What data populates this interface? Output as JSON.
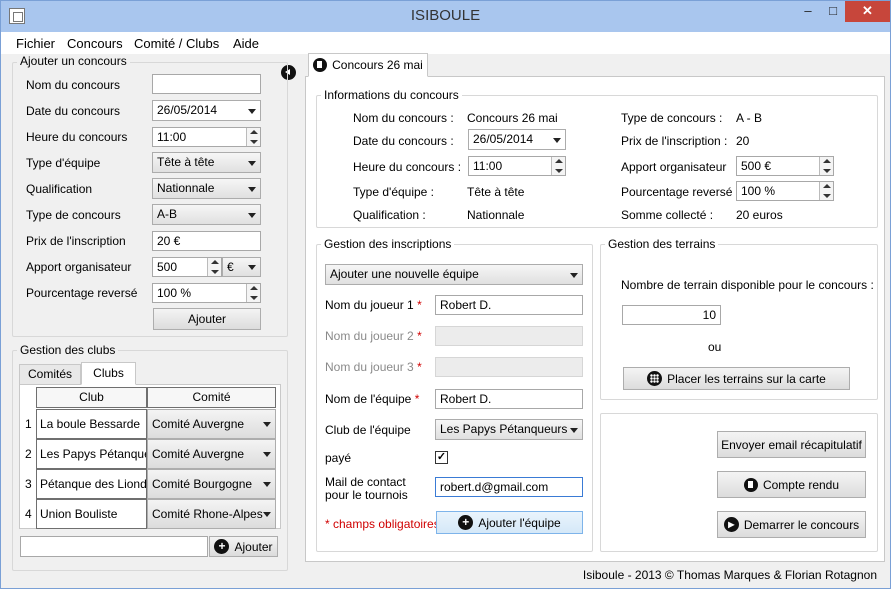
{
  "window": {
    "title": "ISIBOULE"
  },
  "menu": [
    "Fichier",
    "Concours",
    "Comité / Clubs",
    "Aide"
  ],
  "left": {
    "add_group_title": "Ajouter un concours",
    "fields": {
      "nom_label": "Nom du concours",
      "nom_value": "",
      "date_label": "Date du concours",
      "date_value": "26/05/2014",
      "heure_label": "Heure du concours",
      "heure_value": "11:00",
      "type_equipe_label": "Type d'équipe",
      "type_equipe_value": "Tête à tête",
      "qualification_label": "Qualification",
      "qualification_value": "Nationnale",
      "type_concours_label": "Type de concours",
      "type_concours_value": "A-B",
      "prix_label": "Prix de l'inscription",
      "prix_value": "20 €",
      "apport_label": "Apport organisateur",
      "apport_value": "500",
      "apport_currency": "€",
      "pourcentage_label": "Pourcentage reversé",
      "pourcentage_value": "100 %"
    },
    "add_button": "Ajouter",
    "clubs_group_title": "Gestion des clubs",
    "tabs": [
      "Comités",
      "Clubs"
    ],
    "table_headers": [
      "Club",
      "Comité"
    ],
    "rows": [
      {
        "num": "1",
        "club": "La boule Bessarde",
        "comite": "Comité Auvergne"
      },
      {
        "num": "2",
        "club": "Les Papys Pétanqueurs",
        "comite": "Comité Auvergne"
      },
      {
        "num": "3",
        "club": "Pétanque des Liondais",
        "comite": "Comité Bourgogne"
      },
      {
        "num": "4",
        "club": "Union Bouliste",
        "comite": "Comité Rhone-Alpes"
      }
    ],
    "new_club_value": "",
    "add_club_button": "Ajouter"
  },
  "tab": {
    "label": "Concours 26 mai"
  },
  "info": {
    "title": "Informations du concours",
    "nom_label": "Nom du concours :",
    "nom_value": "Concours 26 mai",
    "date_label": "Date du concours :",
    "date_value": "26/05/2014",
    "heure_label": "Heure du concours :",
    "heure_value": "11:00",
    "type_equipe_label": "Type d'équipe :",
    "type_equipe_value": "Tête à tête",
    "qualification_label": "Qualification :",
    "qualification_value": "Nationnale",
    "type_concours_label": "Type de concours :",
    "type_concours_value": "A - B",
    "prix_label": "Prix de l'inscription :",
    "prix_value": "20",
    "apport_label": "Apport organisateur",
    "apport_value": "500 €",
    "pourcentage_label": "Pourcentage reversé",
    "pourcentage_value": "100 %",
    "somme_label": "Somme collecté :",
    "somme_value": "20 euros"
  },
  "inscriptions": {
    "title": "Gestion des inscriptions",
    "mode_value": "Ajouter une nouvelle équipe",
    "joueur1_label": "Nom du joueur 1",
    "joueur1_value": "Robert D.",
    "joueur2_label": "Nom du joueur 2",
    "joueur2_value": "",
    "joueur3_label": "Nom du joueur 3",
    "joueur3_value": "",
    "equipe_label": "Nom de l'équipe",
    "equipe_value": "Robert D.",
    "club_label": "Club de l'équipe",
    "club_value": "Les Papys Pétanqueurs",
    "paye_label": "payé",
    "paye_checked": "✓",
    "mail_label_1": "Mail de contact",
    "mail_label_2": "pour le tournois",
    "mail_value": "robert.d@gmail.com",
    "required_star": "*",
    "required_note": "* champs obligatoires",
    "add_team_button": "Ajouter l'équipe"
  },
  "terrains": {
    "title": "Gestion des terrains",
    "nombre_label": "Nombre de terrain disponible pour le concours :",
    "nombre_value": "10",
    "ou": "ou",
    "place_button": "Placer les terrains sur la carte"
  },
  "actions": {
    "email_button": "Envoyer email récapitulatif",
    "report_button": "Compte rendu",
    "start_button": "Demarrer le concours"
  },
  "footer": "Isiboule - 2013 © Thomas Marques & Florian Rotagnon"
}
